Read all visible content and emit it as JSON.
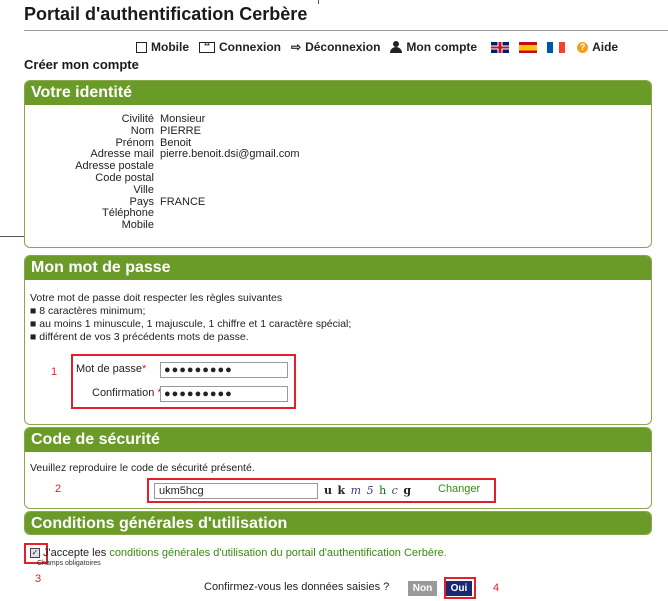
{
  "header": {
    "title": "Portail d'authentification Cerbère",
    "create_title": "Créer mon compte"
  },
  "nav": {
    "mobile": "Mobile",
    "login": "Connexion",
    "logout": "Déconnexion",
    "account": "Mon compte",
    "help": "Aide",
    "icons": [
      "checkbox-icon",
      "key-icon",
      "exit-icon",
      "user-icon",
      "help-icon"
    ],
    "flags": [
      "uk-flag",
      "spain-flag",
      "france-flag"
    ]
  },
  "identity": {
    "heading": "Votre identité",
    "rows": [
      {
        "label": "Civilité",
        "value": "Monsieur"
      },
      {
        "label": "Nom",
        "value": "PIERRE"
      },
      {
        "label": "Prénom",
        "value": "Benoit"
      },
      {
        "label": "Adresse mail",
        "value": "pierre.benoit.dsi@gmail.com"
      },
      {
        "label": "Adresse postale",
        "value": ""
      },
      {
        "label": "Code postal",
        "value": ""
      },
      {
        "label": "Ville",
        "value": ""
      },
      {
        "label": "Pays",
        "value": "FRANCE"
      },
      {
        "label": "Téléphone",
        "value": ""
      },
      {
        "label": "Mobile",
        "value": ""
      }
    ]
  },
  "password": {
    "heading": "Mon mot de passe",
    "rules_intro": "Votre mot de passe doit respecter les règles suivantes",
    "rules": [
      "8 caractères minimum;",
      "au moins 1 minuscule, 1 majuscule, 1 chiffre et 1 caractère spécial;",
      "différent de vos 3 précédents mots de passe."
    ],
    "marker": "1",
    "field_label": "Mot de passe",
    "confirm_label": "Confirmation",
    "required_mark": "*",
    "field_value": "●●●●●●●●●",
    "confirm_value": "●●●●●●●●●"
  },
  "security": {
    "heading": "Code de sécurité",
    "instruction": "Veuillez reproduire le code de sécurité présenté.",
    "marker": "2",
    "input_value": "ukm5hcg",
    "captcha_chars": [
      "u",
      "k",
      "m",
      "5",
      "h",
      "c",
      "g"
    ],
    "change_label": "Changer"
  },
  "cgu": {
    "heading": "Conditions générales d'utilisation",
    "accept_prefix": "J'accepte les ",
    "accept_link": "conditions générales d'utilisation du portail d'authentification Cerbère.",
    "required_note": "Champs obligatoires",
    "marker_checkbox": "3",
    "confirm_question": "Confirmez-vous les données saisies ?",
    "no_label": "Non",
    "yes_label": "Oui",
    "marker_yes": "4"
  },
  "colors": {
    "section_header": "#6a9a28",
    "annotation_red": "#e0202a",
    "link_green": "#3a8a10",
    "yes_button": "#1a2a70",
    "no_button": "#9a9a9a"
  }
}
